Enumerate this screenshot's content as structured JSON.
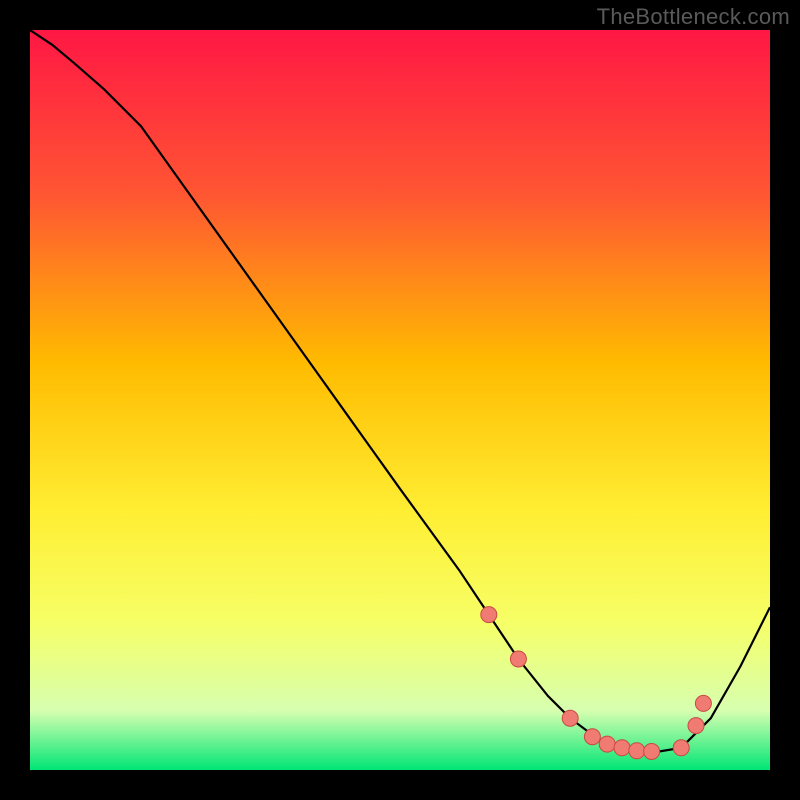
{
  "watermark": "TheBottleneck.com",
  "colors": {
    "bg_black": "#000000",
    "grad_top": "#ff1744",
    "grad_mid1": "#ff5533",
    "grad_mid2": "#ffbb00",
    "grad_mid3": "#ffee33",
    "grad_mid4": "#f6ff66",
    "grad_low": "#d7ffb0",
    "grad_base": "#00e676",
    "curve": "#000000",
    "marker_fill": "#ef7b73",
    "marker_stroke": "#c94a42"
  },
  "chart_data": {
    "type": "line",
    "title": "",
    "xlabel": "",
    "ylabel": "",
    "xlim": [
      0,
      100
    ],
    "ylim": [
      0,
      100
    ],
    "series": [
      {
        "name": "bottleneck-curve",
        "x": [
          0,
          3,
          6,
          10,
          15,
          20,
          30,
          40,
          50,
          58,
          62,
          66,
          70,
          73,
          77,
          80,
          82,
          85,
          88,
          92,
          96,
          100
        ],
        "y": [
          100,
          98,
          95.5,
          92,
          87,
          80,
          66,
          52,
          38,
          27,
          21,
          15,
          10,
          7,
          4,
          3,
          2.6,
          2.5,
          3,
          7,
          14,
          22
        ]
      }
    ],
    "markers": {
      "name": "highlight-points",
      "x": [
        62,
        66,
        73,
        76,
        78,
        80,
        82,
        84,
        88,
        90,
        91
      ],
      "y": [
        21,
        15,
        7,
        4.5,
        3.5,
        3,
        2.6,
        2.5,
        3,
        6,
        9
      ]
    }
  }
}
